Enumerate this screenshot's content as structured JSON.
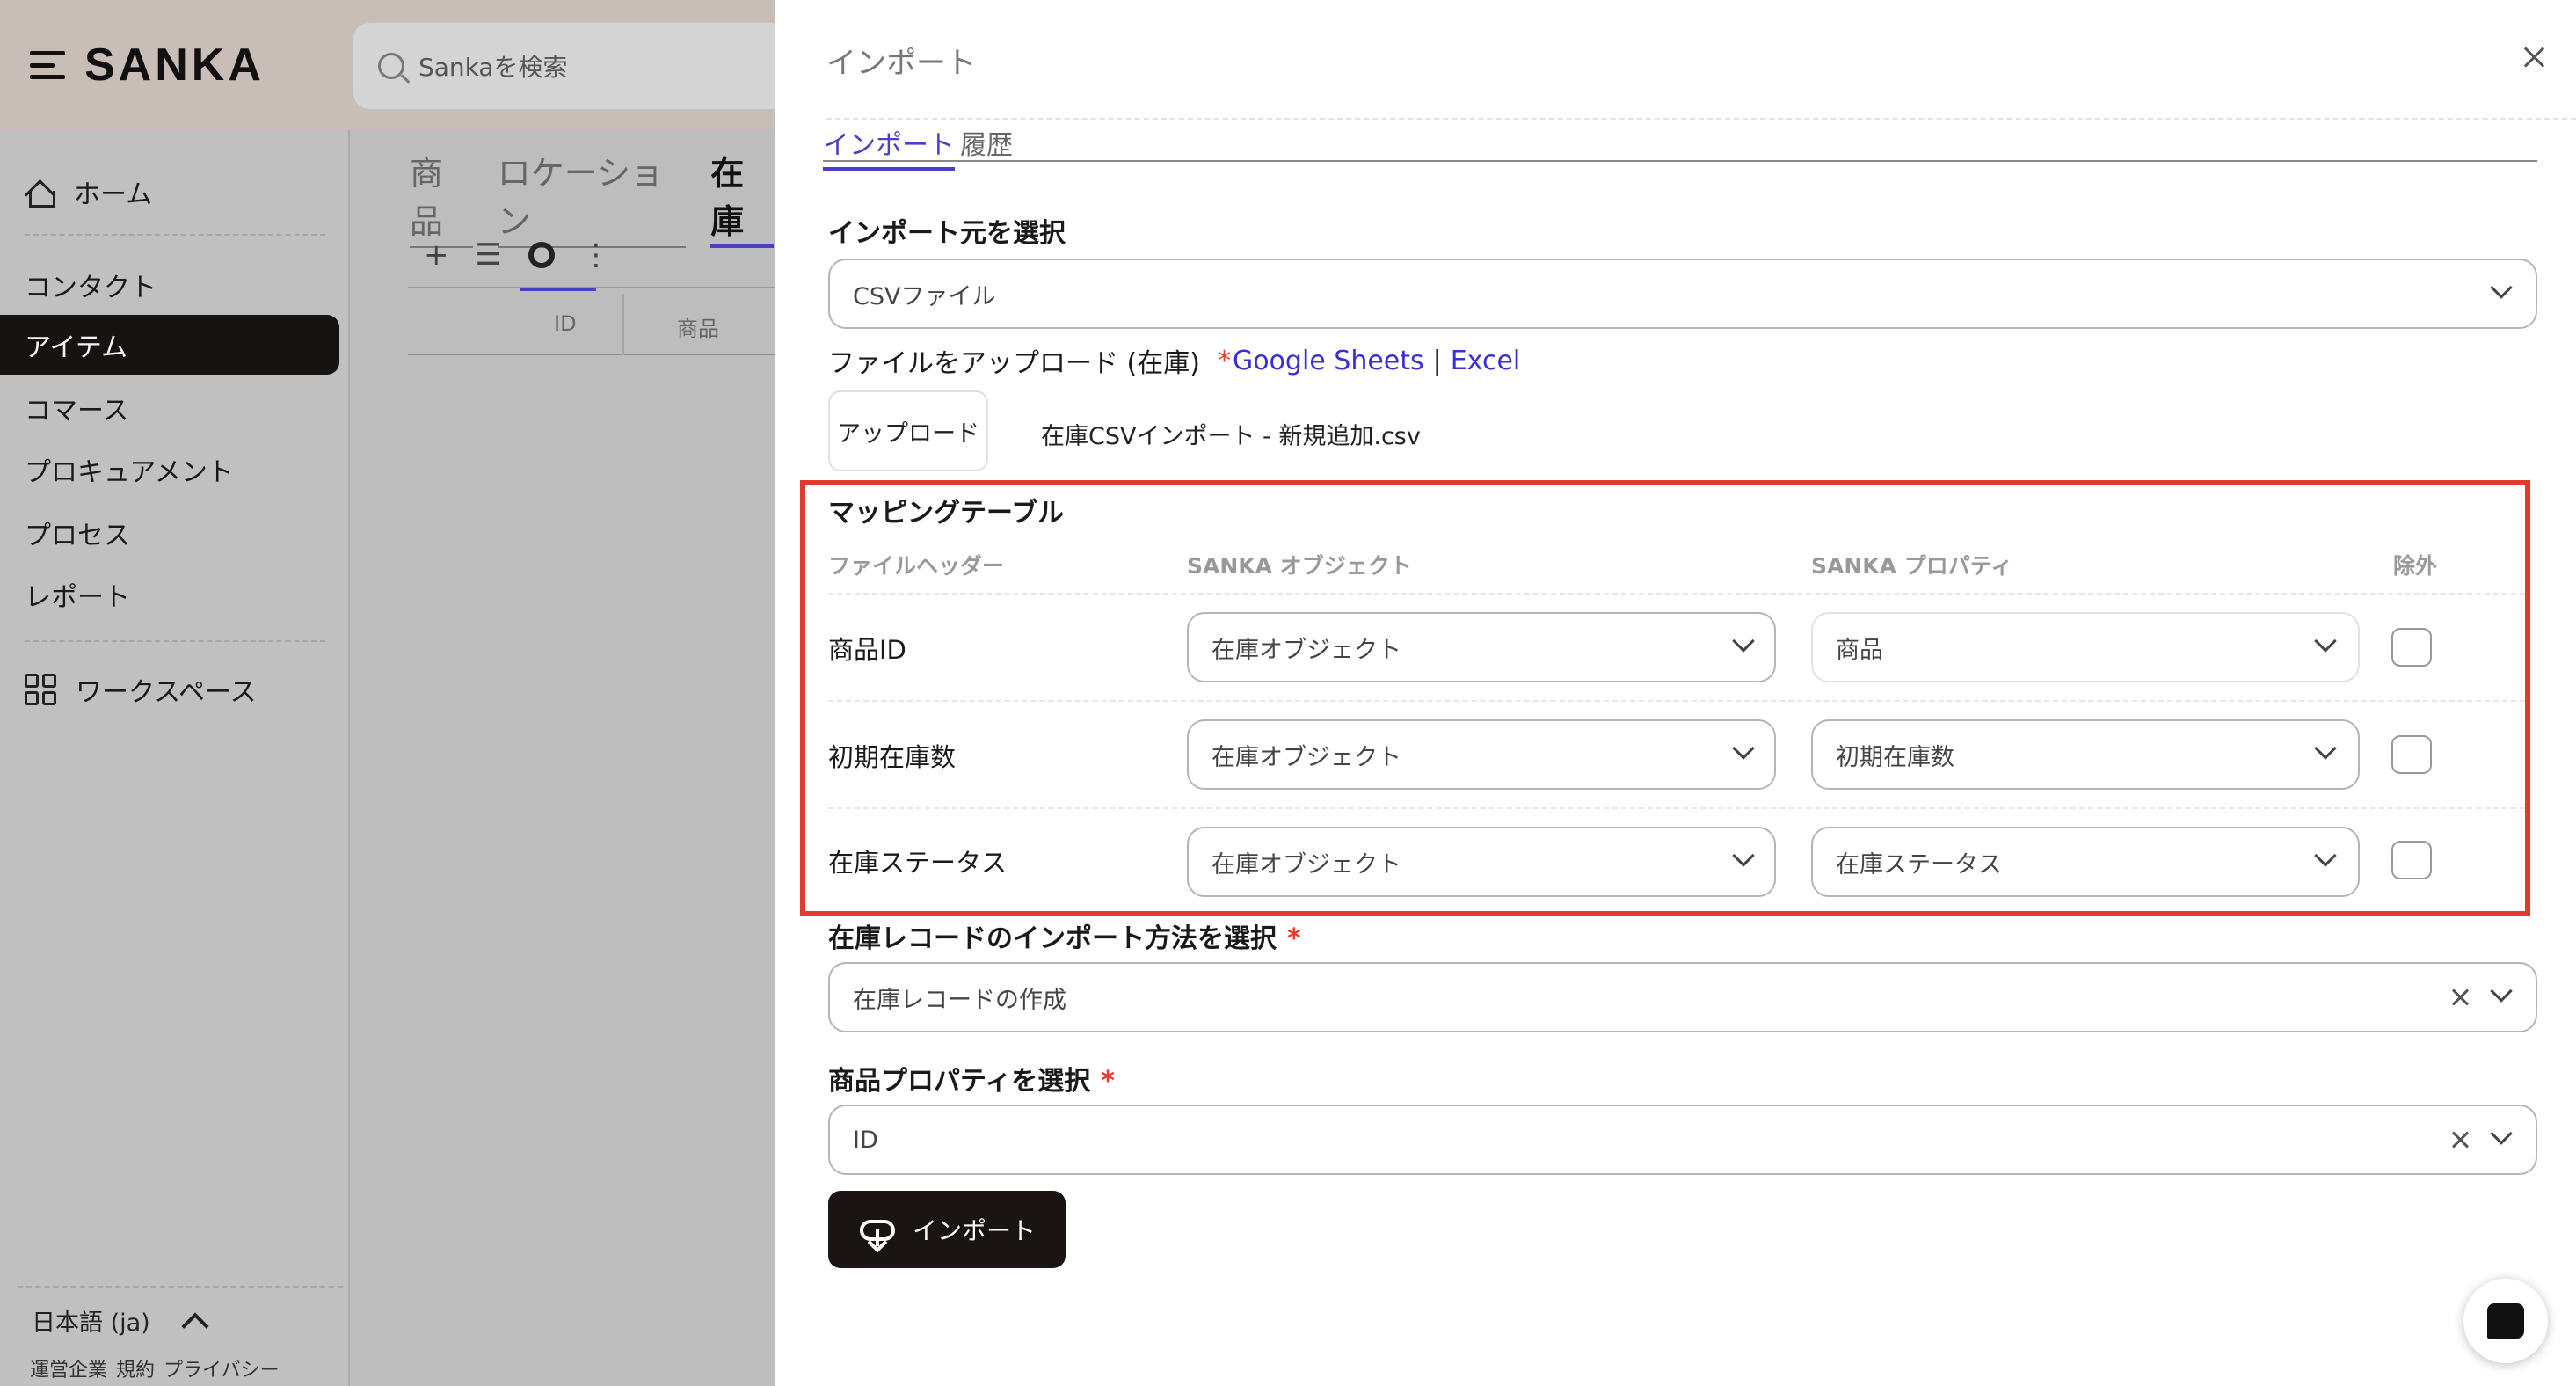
{
  "brand": {
    "name": "SANKA"
  },
  "search": {
    "placeholder": "Sankaを検索"
  },
  "sidebar": {
    "items": [
      {
        "label": "ホーム"
      },
      {
        "label": "コンタクト"
      },
      {
        "label": "アイテム"
      },
      {
        "label": "コマース"
      },
      {
        "label": "プロキュアメント"
      },
      {
        "label": "プロセス"
      },
      {
        "label": "レポート"
      },
      {
        "label": "ワークスペース"
      }
    ],
    "language": "日本語 (ja)",
    "footer_links": [
      "運営企業",
      "規約",
      "プライバシー"
    ]
  },
  "background": {
    "tabs": [
      "商品",
      "ロケーション",
      "在庫"
    ],
    "toolbar": {
      "add": "+",
      "list": "☰",
      "more": "⋮"
    },
    "table_headers": [
      "ID",
      "商品"
    ]
  },
  "drawer": {
    "title": "インポート",
    "tabs": [
      {
        "label": "インポート",
        "active": true
      },
      {
        "label": "履歴",
        "active": false
      }
    ],
    "source": {
      "label": "インポート元を選択",
      "value": "CSVファイル"
    },
    "upload": {
      "label": "ファイルをアップロード (在庫)",
      "star": "*",
      "link_google": "Google Sheets",
      "divider": "|",
      "link_excel": "Excel",
      "button": "アップロード",
      "file_name": "在庫CSVインポート - 新規追加.csv"
    },
    "mapping": {
      "title": "マッピングテーブル",
      "headers": {
        "file_header": "ファイルヘッダー",
        "object": "SANKA オブジェクト",
        "property": "SANKA プロパティ",
        "exclude": "除外"
      },
      "rows": [
        {
          "file_header": "商品ID",
          "object": "在庫オブジェクト",
          "property": "商品",
          "excluded": false
        },
        {
          "file_header": "初期在庫数",
          "object": "在庫オブジェクト",
          "property": "初期在庫数",
          "excluded": false
        },
        {
          "file_header": "在庫ステータス",
          "object": "在庫オブジェクト",
          "property": "在庫ステータス",
          "excluded": false
        }
      ]
    },
    "method": {
      "label": "在庫レコードのインポート方法を選択",
      "required_mark": "*",
      "value": "在庫レコードの作成"
    },
    "item_property": {
      "label": "商品プロパティを選択",
      "required_mark": "*",
      "value": "ID"
    },
    "import_button": "インポート"
  },
  "colors": {
    "accent": "#4a3fc0",
    "highlight_border": "#e23b2e",
    "primary_button": "#1a1412",
    "sidebar_active": "#171311"
  }
}
